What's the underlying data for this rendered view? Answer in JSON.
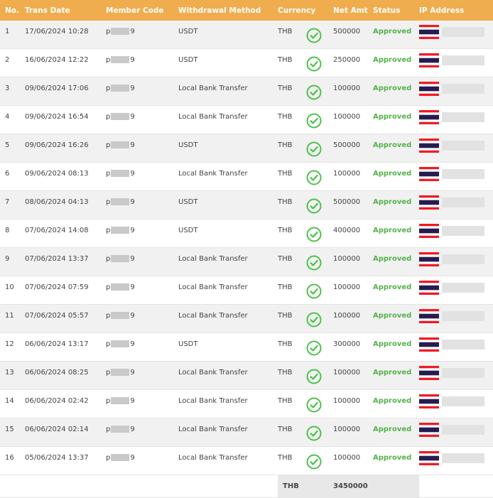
{
  "colors": {
    "header_bg": "#f0ad4e",
    "approved": "#55b24a",
    "check": "#4cc14a"
  },
  "headers": {
    "no": "No.",
    "trans_date": "Trans Date",
    "member_code": "Member Code",
    "method": "Withdrawal Method",
    "currency": "Currency",
    "net_amt": "Net Amt",
    "status": "Status",
    "ip": "IP Address"
  },
  "rows": [
    {
      "no": "1",
      "date": "17/06/2024 10:28",
      "code_prefix": "p",
      "code_suffix": "9",
      "method": "USDT",
      "currency": "THB",
      "amount": "500000",
      "status": "Approved"
    },
    {
      "no": "2",
      "date": "16/06/2024 12:22",
      "code_prefix": "p",
      "code_suffix": "9",
      "method": "USDT",
      "currency": "THB",
      "amount": "250000",
      "status": "Approved"
    },
    {
      "no": "3",
      "date": "09/06/2024 17:06",
      "code_prefix": "p",
      "code_suffix": "9",
      "method": "Local Bank Transfer",
      "currency": "THB",
      "amount": "100000",
      "status": "Approved"
    },
    {
      "no": "4",
      "date": "09/06/2024 16:54",
      "code_prefix": "p",
      "code_suffix": "9",
      "method": "Local Bank Transfer",
      "currency": "THB",
      "amount": "100000",
      "status": "Approved"
    },
    {
      "no": "5",
      "date": "09/06/2024 16:26",
      "code_prefix": "p",
      "code_suffix": "9",
      "method": "USDT",
      "currency": "THB",
      "amount": "500000",
      "status": "Approved"
    },
    {
      "no": "6",
      "date": "09/06/2024 08:13",
      "code_prefix": "p",
      "code_suffix": "9",
      "method": "Local Bank Transfer",
      "currency": "THB",
      "amount": "100000",
      "status": "Approved"
    },
    {
      "no": "7",
      "date": "08/06/2024 04:13",
      "code_prefix": "p",
      "code_suffix": "9",
      "method": "USDT",
      "currency": "THB",
      "amount": "500000",
      "status": "Approved"
    },
    {
      "no": "8",
      "date": "07/06/2024 14:08",
      "code_prefix": "p",
      "code_suffix": "9",
      "method": "USDT",
      "currency": "THB",
      "amount": "400000",
      "status": "Approved"
    },
    {
      "no": "9",
      "date": "07/06/2024 13:37",
      "code_prefix": "p",
      "code_suffix": "9",
      "method": "Local Bank Transfer",
      "currency": "THB",
      "amount": "100000",
      "status": "Approved"
    },
    {
      "no": "10",
      "date": "07/06/2024 07:59",
      "code_prefix": "p",
      "code_suffix": "9",
      "method": "Local Bank Transfer",
      "currency": "THB",
      "amount": "100000",
      "status": "Approved"
    },
    {
      "no": "11",
      "date": "07/06/2024 05:57",
      "code_prefix": "p",
      "code_suffix": "9",
      "method": "Local Bank Transfer",
      "currency": "THB",
      "amount": "100000",
      "status": "Approved"
    },
    {
      "no": "12",
      "date": "06/06/2024 13:17",
      "code_prefix": "p",
      "code_suffix": "9",
      "method": "USDT",
      "currency": "THB",
      "amount": "300000",
      "status": "Approved"
    },
    {
      "no": "13",
      "date": "06/06/2024 08:25",
      "code_prefix": "p",
      "code_suffix": "9",
      "method": "Local Bank Transfer",
      "currency": "THB",
      "amount": "100000",
      "status": "Approved"
    },
    {
      "no": "14",
      "date": "06/06/2024 02:42",
      "code_prefix": "p",
      "code_suffix": "9",
      "method": "Local Bank Transfer",
      "currency": "THB",
      "amount": "100000",
      "status": "Approved"
    },
    {
      "no": "15",
      "date": "06/06/2024 02:14",
      "code_prefix": "p",
      "code_suffix": "9",
      "method": "Local Bank Transfer",
      "currency": "THB",
      "amount": "100000",
      "status": "Approved"
    },
    {
      "no": "16",
      "date": "05/06/2024 13:37",
      "code_prefix": "p",
      "code_suffix": "9",
      "method": "Local Bank Transfer",
      "currency": "THB",
      "amount": "100000",
      "status": "Approved"
    }
  ],
  "footer": {
    "currency": "THB",
    "total": "3450000"
  }
}
